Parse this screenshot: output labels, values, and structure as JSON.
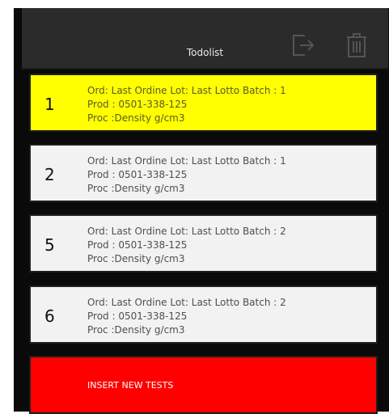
{
  "header": {
    "title": "Todolist",
    "logout_icon": "logout-icon",
    "trash_icon": "trash-icon"
  },
  "items": [
    {
      "number": "1",
      "line1": "Ord: Last Ordine Lot: Last Lotto Batch : 1",
      "line2": "Prod : 0501-338-125",
      "line3": "Proc :Density g/cm3",
      "selected": true
    },
    {
      "number": "2",
      "line1": "Ord: Last Ordine Lot: Last Lotto Batch : 1",
      "line2": "Prod : 0501-338-125",
      "line3": "Proc :Density g/cm3",
      "selected": false
    },
    {
      "number": "5",
      "line1": "Ord: Last Ordine Lot: Last Lotto Batch : 2",
      "line2": "Prod : 0501-338-125",
      "line3": "Proc :Density g/cm3",
      "selected": false
    },
    {
      "number": "6",
      "line1": "Ord: Last Ordine Lot: Last Lotto Batch : 2",
      "line2": "Prod : 0501-338-125",
      "line3": "Proc :Density g/cm3",
      "selected": false
    }
  ],
  "insert_button": {
    "label": "INSERT NEW TESTS"
  },
  "colors": {
    "selected_row": "#ffff00",
    "normal_row": "#f2f2f2",
    "insert_button": "#ff0000",
    "header": "#2b2b2b",
    "background": "#0a0a0a"
  }
}
